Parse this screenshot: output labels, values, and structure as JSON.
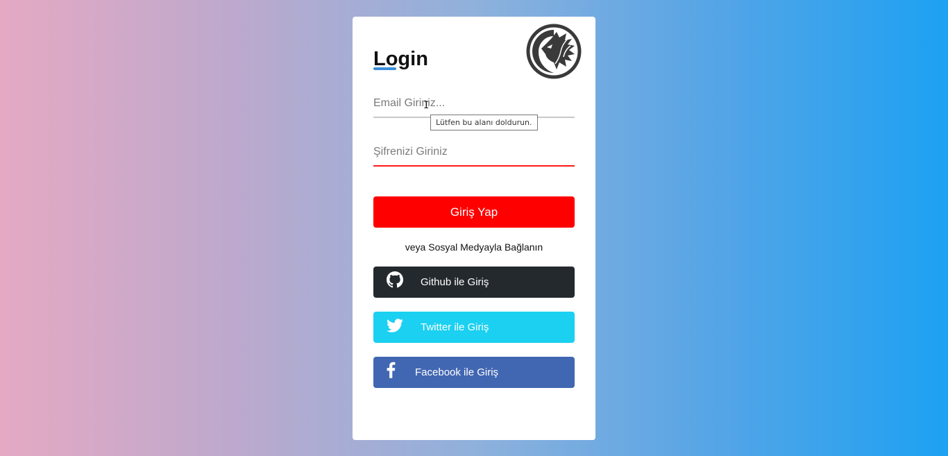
{
  "login": {
    "title": "Login",
    "email_placeholder": "Email Giriniz...",
    "password_placeholder": "Şifrenizi Giriniz",
    "tooltip": "Lütfen bu alanı doldurun.",
    "submit_label": "Giriş Yap",
    "social_text": "veya Sosyal Medyayla Bağlanın"
  },
  "social": {
    "github_label": "Github ile Giriş",
    "twitter_label": "Twitter ile Giriş",
    "facebook_label": "Facebook ile Giriş"
  },
  "icons": {
    "logo": "dragon-logo-icon",
    "github": "github-icon",
    "twitter": "twitter-icon",
    "facebook": "facebook-icon"
  },
  "colors": {
    "login_button": "#ff0000",
    "github": "#24292e",
    "twitter": "#1bd0f0",
    "facebook": "#4267b2",
    "accent": "#3b8fd9"
  }
}
